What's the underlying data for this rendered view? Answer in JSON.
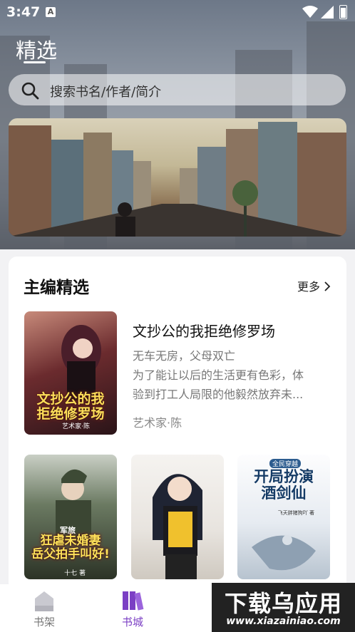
{
  "status_bar": {
    "time": "3:47",
    "notification_icon": "A"
  },
  "header": {
    "title": "精选"
  },
  "search": {
    "placeholder": "搜索书名/作者/简介"
  },
  "section": {
    "title": "主编精选",
    "more_label": "更多"
  },
  "featured_book": {
    "title": "文抄公的我拒绝修罗场",
    "description_lines": [
      "无车无房，父母双亡",
      "为了能让以后的生活更有色彩，体",
      "验到打工人局限的他毅然放弃未..."
    ],
    "author": "艺术家·陈",
    "cover_title_lines": [
      "文抄公的我",
      "拒绝修罗场"
    ],
    "cover_author": "艺术家·陈"
  },
  "books": [
    {
      "cover_tag": "军旅",
      "cover_title_lines": [
        "狂虐未婚妻",
        "岳父拍手叫好!"
      ],
      "cover_author": "十七 著"
    },
    {
      "cover_title_lines": [],
      "cover_author": ""
    },
    {
      "cover_tag": "全民穿越",
      "cover_title_lines": [
        "开局扮演",
        "酒剑仙"
      ],
      "cover_author": "飞天胖猪狗吖 著"
    }
  ],
  "tabs": [
    {
      "label": "书架",
      "active": false
    },
    {
      "label": "书城",
      "active": true
    }
  ],
  "watermark": {
    "main": "下载乌应用",
    "sub": "www.xiazainiao.com"
  },
  "colors": {
    "accent": "#7b3fc4",
    "inactive": "#9a9aa2"
  }
}
